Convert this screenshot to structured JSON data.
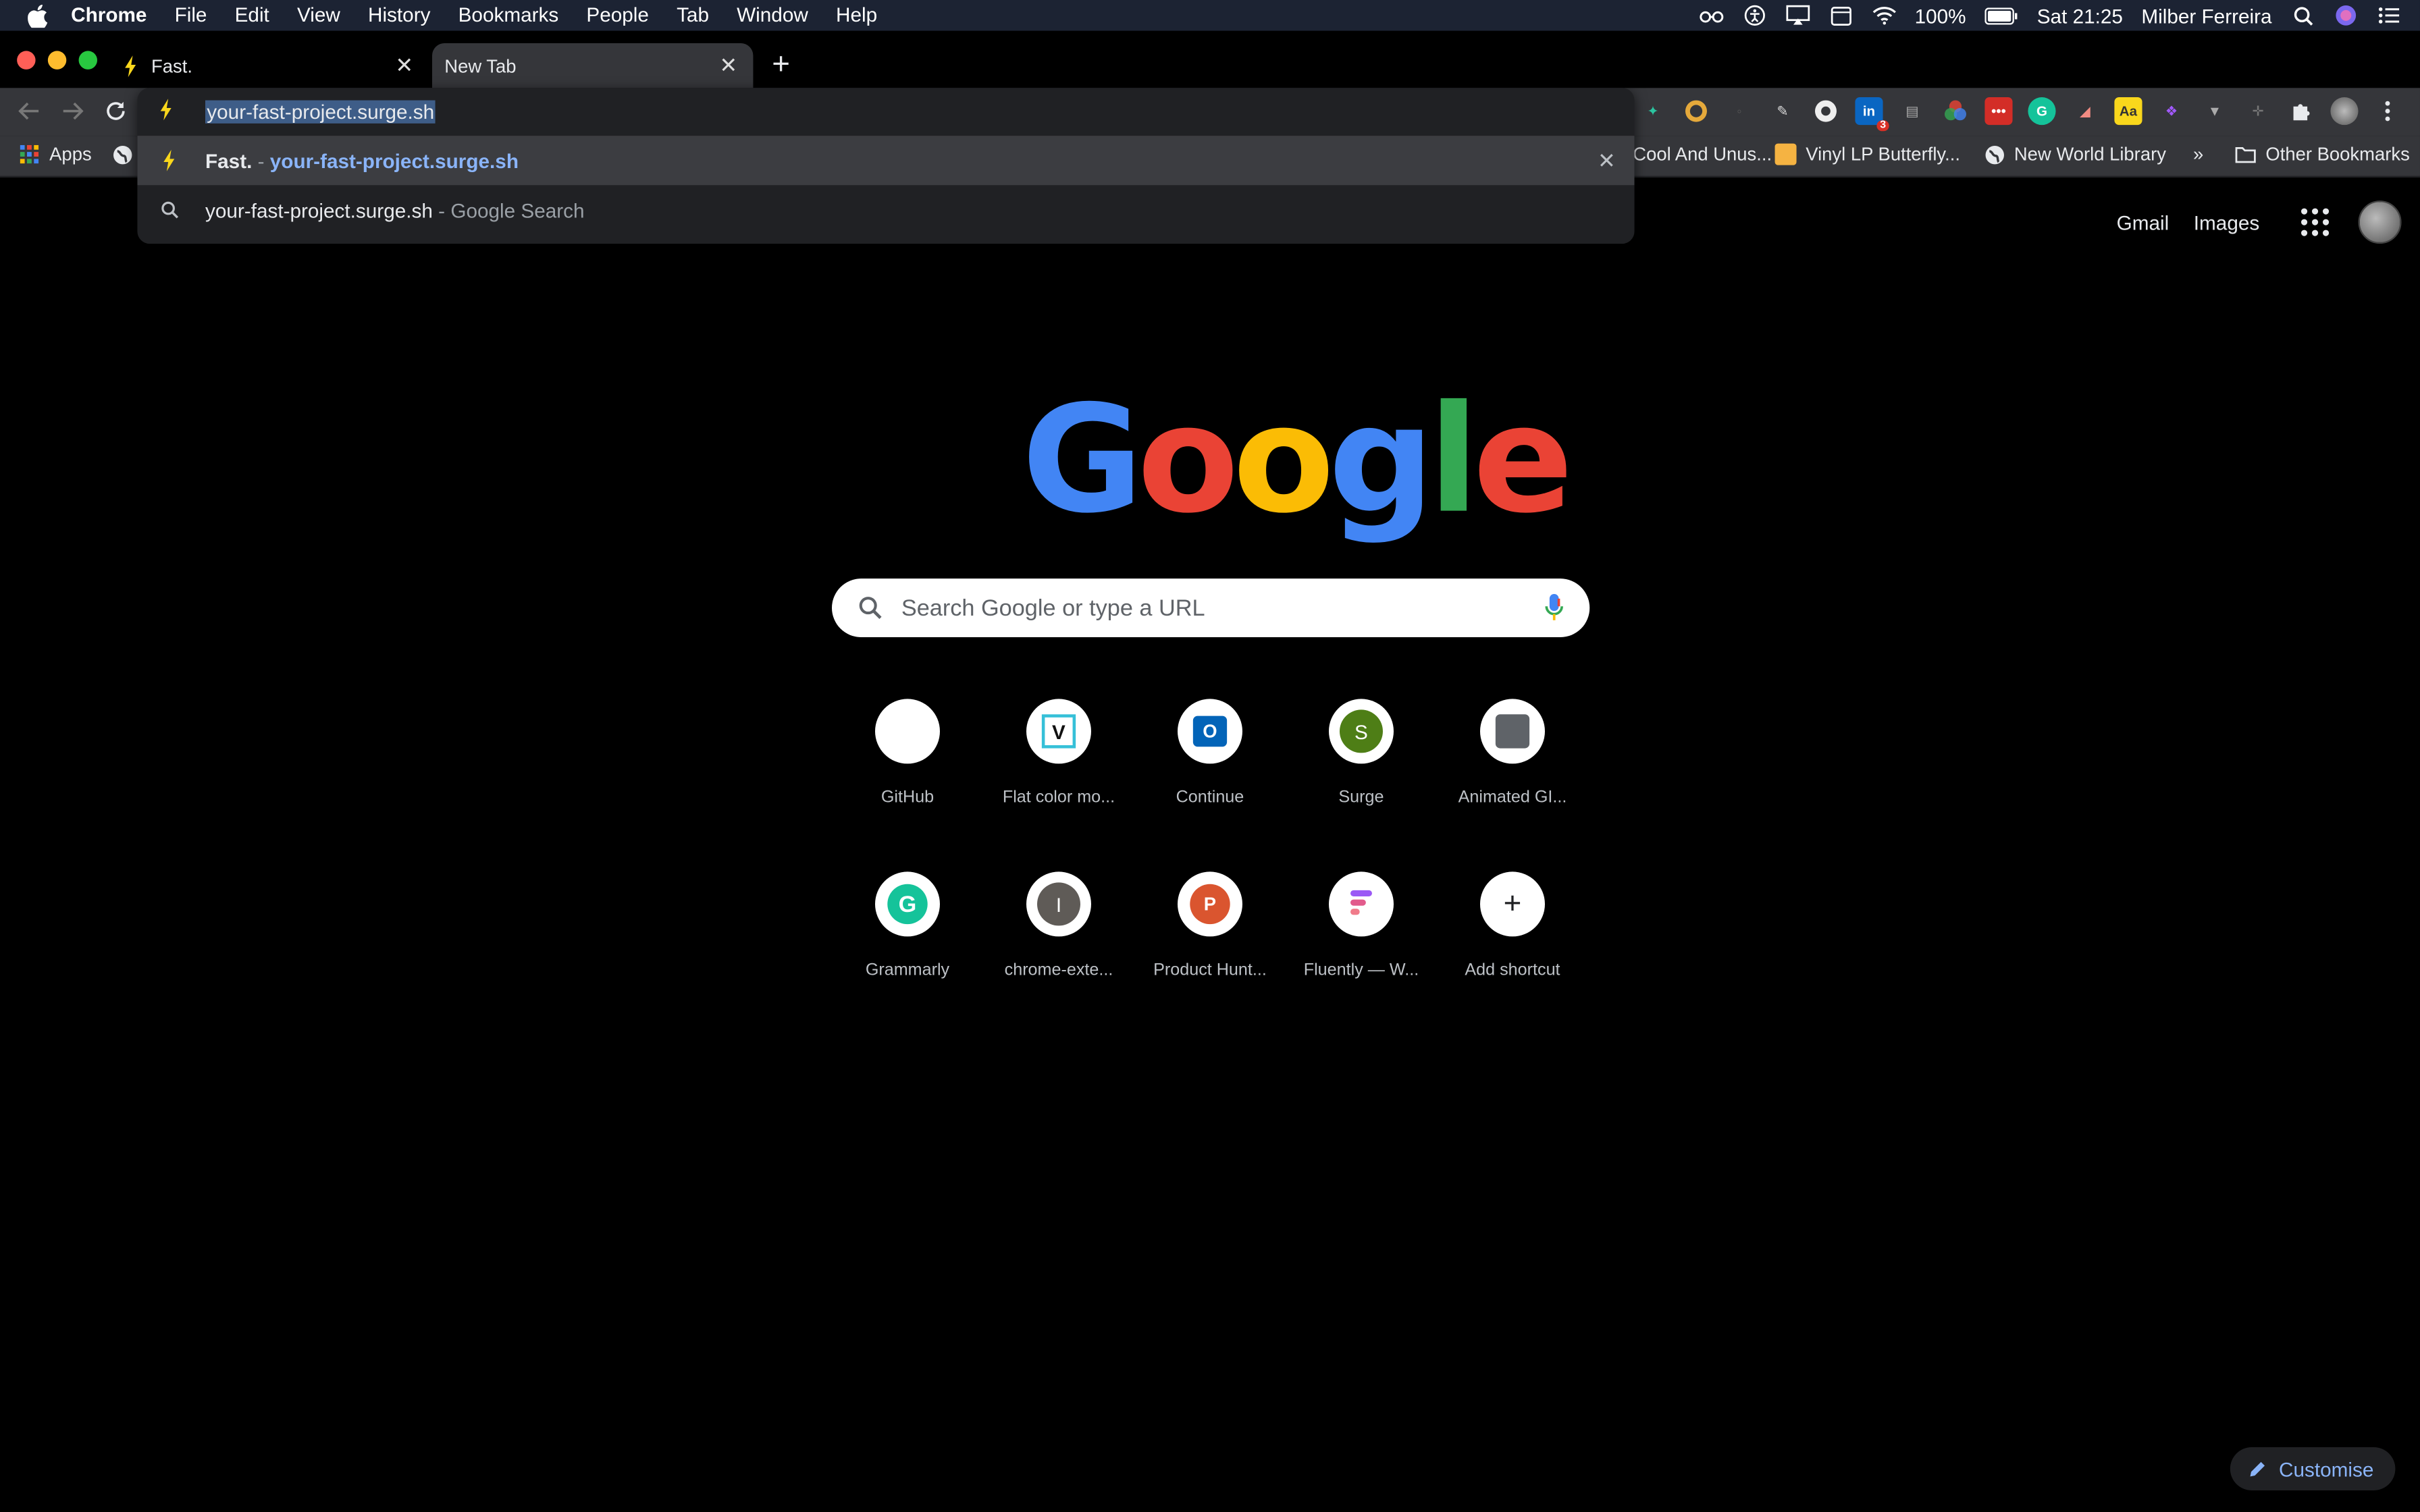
{
  "menubar": {
    "items": [
      "Chrome",
      "File",
      "Edit",
      "View",
      "History",
      "Bookmarks",
      "People",
      "Tab",
      "Window",
      "Help"
    ],
    "battery": "100%",
    "clock": "Sat 21:25",
    "user": "Milber Ferreira"
  },
  "tabs": [
    {
      "title": "Fast."
    },
    {
      "title": "New Tab"
    }
  ],
  "omnibox": {
    "value": "your-fast-project.surge.sh",
    "suggestions": [
      {
        "title": "Fast.",
        "sep": " - ",
        "url": "your-fast-project.surge.sh"
      },
      {
        "query": "your-fast-project.surge.sh",
        "suffix": " - Google Search"
      }
    ]
  },
  "bookmarks": {
    "apps": "Apps",
    "cool": "Cool And Unus...",
    "vinyl": "Vinyl LP Butterfly...",
    "newworld": "New World Library",
    "more": "»",
    "other": "Other Bookmarks"
  },
  "extensions": {
    "linkedin_badge": "3",
    "dictionary": "Aa"
  },
  "google": {
    "gmail": "Gmail",
    "images": "Images",
    "search_placeholder": "Search Google or type a URL",
    "customise": "Customise"
  },
  "shortcuts": [
    {
      "label": "GitHub",
      "glyph": ""
    },
    {
      "label": "Flat color mo...",
      "glyph": "V"
    },
    {
      "label": "Continue",
      "glyph": "O"
    },
    {
      "label": "Surge",
      "glyph": "S"
    },
    {
      "label": "Animated GI...",
      "glyph": ""
    },
    {
      "label": "Grammarly",
      "glyph": "G"
    },
    {
      "label": "chrome-exte...",
      "glyph": "I"
    },
    {
      "label": "Product Hunt...",
      "glyph": "P"
    },
    {
      "label": "Fluently — W...",
      "glyph": ""
    },
    {
      "label": "Add shortcut",
      "glyph": "+"
    }
  ],
  "colors": {
    "google_blue": "#4285f4",
    "google_red": "#ea4335",
    "google_yellow": "#fbbc05",
    "google_green": "#34a853",
    "link_blue": "#8ab4f8"
  }
}
